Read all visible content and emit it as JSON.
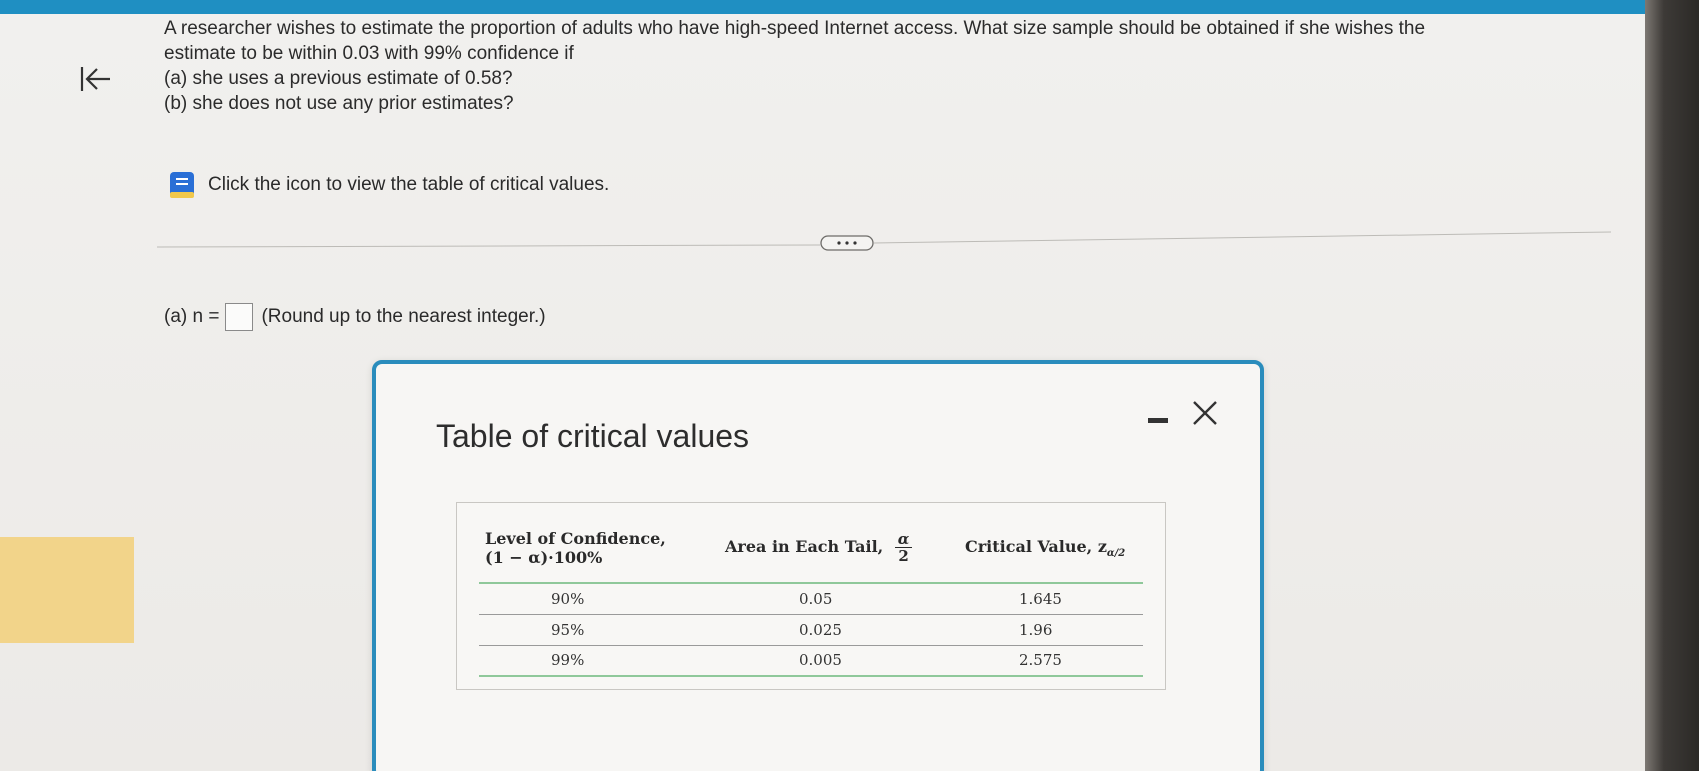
{
  "question": {
    "line1": "A researcher wishes to estimate the proportion of adults who have high-speed Internet access. What size sample should be obtained if she wishes the",
    "line2": "estimate to be within 0.03 with 99% confidence if",
    "part_a": "(a) she uses a previous estimate of 0.58?",
    "part_b": "(b) she does not use any prior estimates?"
  },
  "table_link": {
    "label": "Click the icon to view the table of critical values.",
    "icon": "book-icon"
  },
  "answer": {
    "prefix": "(a) n =",
    "value": "",
    "hint": "(Round up to the nearest integer.)"
  },
  "dialog": {
    "title": "Table of critical values",
    "table": {
      "headers": {
        "level_line1": "Level of Confidence,",
        "level_line2": "(1 − α)·100%",
        "tail_label": "Area in Each Tail,",
        "tail_num": "α",
        "tail_den": "2",
        "crit_label": "Critical Value, z",
        "crit_sub": "α/2"
      },
      "rows": [
        {
          "level": "90%",
          "tail": "0.05",
          "critical": "1.645"
        },
        {
          "level": "95%",
          "tail": "0.025",
          "critical": "1.96"
        },
        {
          "level": "99%",
          "tail": "0.005",
          "critical": "2.575"
        }
      ]
    }
  },
  "colors": {
    "accent": "#2a8cbc",
    "topbar": "#1f8fc2",
    "table_rule": "#8fc89a",
    "side_strip": "#f2d48a"
  }
}
